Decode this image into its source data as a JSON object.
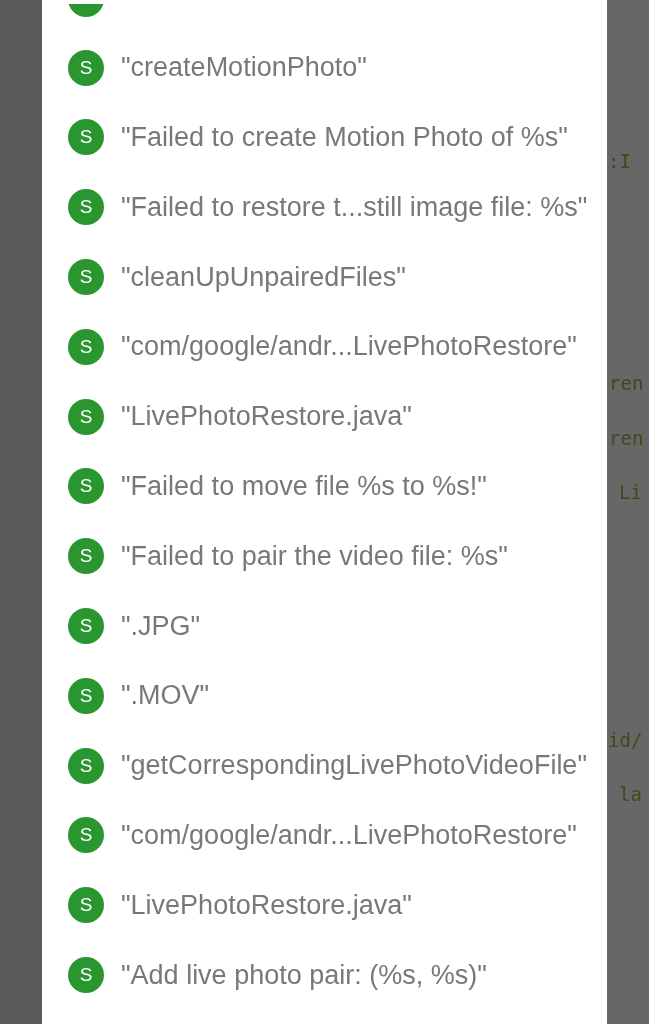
{
  "background_code": {
    "fragments": [
      ":I",
      "ren",
      "ren",
      "Li",
      "id/",
      "la"
    ]
  },
  "dialog": {
    "items": [
      {
        "kind": "clipped"
      },
      {
        "kind": "string",
        "badge": "S",
        "label": "\"createMotionPhoto\""
      },
      {
        "kind": "string",
        "badge": "S",
        "label": "\"Failed to create Motion Photo of %s\""
      },
      {
        "kind": "string",
        "badge": "S",
        "label": "\"Failed to restore t...still image file: %s\""
      },
      {
        "kind": "string",
        "badge": "S",
        "label": "\"cleanUpUnpairedFiles\""
      },
      {
        "kind": "string",
        "badge": "S",
        "label": "\"com/google/andr...LivePhotoRestore\""
      },
      {
        "kind": "string",
        "badge": "S",
        "label": "\"LivePhotoRestore.java\""
      },
      {
        "kind": "string",
        "badge": "S",
        "label": "\"Failed to move file %s to %s!\""
      },
      {
        "kind": "string",
        "badge": "S",
        "label": "\"Failed to pair the video file: %s\""
      },
      {
        "kind": "string",
        "badge": "S",
        "label": "\".JPG\""
      },
      {
        "kind": "string",
        "badge": "S",
        "label": "\".MOV\""
      },
      {
        "kind": "string",
        "badge": "S",
        "label": "\"getCorrespondingLivePhotoVideoFile\""
      },
      {
        "kind": "string",
        "badge": "S",
        "label": "\"com/google/andr...LivePhotoRestore\""
      },
      {
        "kind": "string",
        "badge": "S",
        "label": "\"LivePhotoRestore.java\""
      },
      {
        "kind": "string",
        "badge": "S",
        "label": "\"Add live photo pair: (%s, %s)\""
      }
    ]
  }
}
